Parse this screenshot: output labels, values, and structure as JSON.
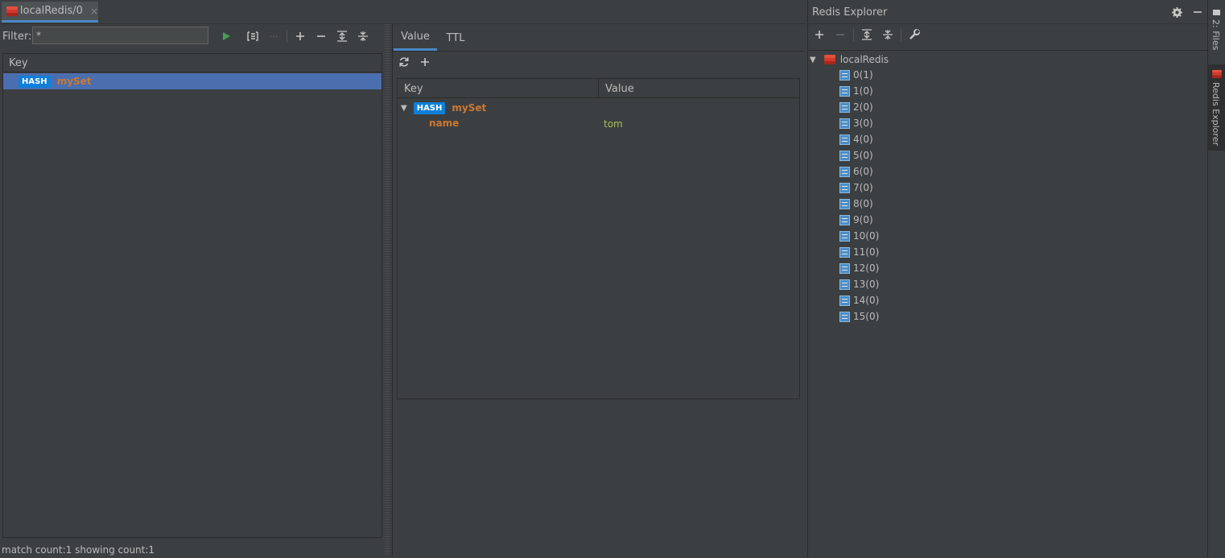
{
  "editor": {
    "tab_label": "localRedis/0",
    "tab_close": "×"
  },
  "filter": {
    "label": "Filter:",
    "value": "*"
  },
  "key_table": {
    "header": "Key",
    "rows": [
      {
        "type": "HASH",
        "name": "mySet"
      }
    ]
  },
  "status": "match count:1 showing count:1",
  "value_panel": {
    "tabs": [
      "Value",
      "TTL"
    ],
    "table": {
      "col_key": "Key",
      "col_value": "Value",
      "root": {
        "type": "HASH",
        "name": "mySet"
      },
      "fields": [
        {
          "key": "name",
          "value": "tom"
        }
      ]
    }
  },
  "explorer": {
    "title": "Redis Explorer",
    "root": "localRedis",
    "databases": [
      "0(1)",
      "1(0)",
      "2(0)",
      "3(0)",
      "4(0)",
      "5(0)",
      "6(0)",
      "7(0)",
      "8(0)",
      "9(0)",
      "10(0)",
      "11(0)",
      "12(0)",
      "13(0)",
      "14(0)",
      "15(0)"
    ]
  },
  "sidebar": {
    "files_label": "2: Files",
    "redis_label": "Redis Explorer"
  },
  "colors": {
    "background": "#3c3f41",
    "selection": "#4b6eaf",
    "hash_badge": "#0f7fd8",
    "key_name": "#cc7832",
    "string_value": "#a5c25c",
    "tab_underline": "#4a88c7"
  }
}
